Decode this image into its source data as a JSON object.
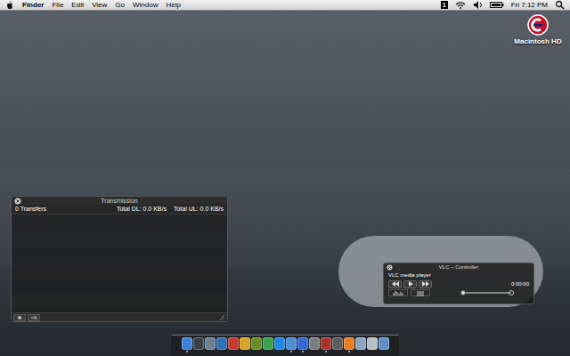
{
  "menu_bar": {
    "app": "Finder",
    "menus": [
      "File",
      "Edit",
      "View",
      "Go",
      "Window",
      "Help"
    ],
    "status_badge": "1",
    "clock": "Fri 7:12 PM"
  },
  "desktop_icons": [
    {
      "label": "Macintosh HD"
    }
  ],
  "transmission": {
    "title": "Transmission",
    "transfers": "0 Transfers",
    "total_dl": "Total DL: 0.0 KB/s",
    "total_ul": "Total UL: 0.0 KB/s"
  },
  "vlc": {
    "title": "VLC – Controller",
    "status": "VLC media player",
    "time": "0:00:00",
    "volume": {
      "level": 0.0
    }
  },
  "dock": {
    "items": [
      {
        "color": "#3b82d6",
        "running": true
      },
      {
        "color": "#3a3f46",
        "running": false
      },
      {
        "color": "#6f7f90",
        "running": false
      },
      {
        "color": "#2f6fb8",
        "running": false
      },
      {
        "color": "#c83a2f",
        "running": false
      },
      {
        "color": "#d9a521",
        "running": false
      },
      {
        "color": "#6b8e23",
        "running": false
      },
      {
        "color": "#37a34a",
        "running": false
      },
      {
        "color": "#1e88e5",
        "running": false
      },
      {
        "color": "#4a90d9",
        "running": true
      },
      {
        "color": "#3367d6",
        "running": true
      },
      {
        "color": "#7a7f86",
        "running": false
      },
      {
        "color": "#a5342a",
        "running": true
      },
      {
        "color": "#585d63",
        "running": false
      },
      {
        "color": "#e67e22",
        "running": true
      },
      {
        "color": "#8ea4bd",
        "running": false
      },
      {
        "color": "#b8bec6",
        "running": false
      },
      {
        "color": "#5f8fc7",
        "running": false
      }
    ]
  }
}
